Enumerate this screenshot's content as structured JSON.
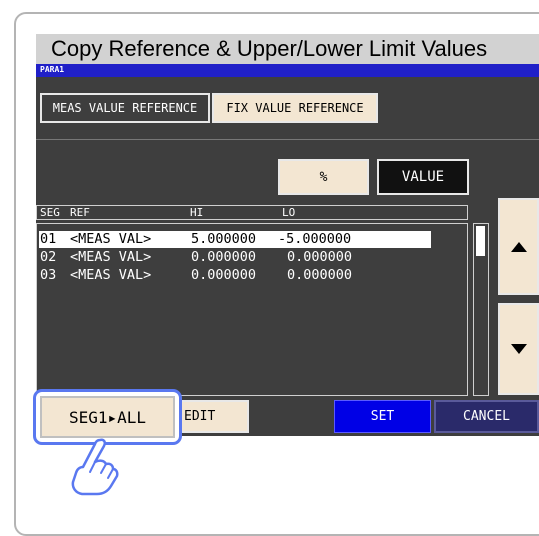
{
  "title": "Copy Reference & Upper/Lower Limit Values",
  "screen_header": "PARA1",
  "reference_tabs": [
    {
      "label": "MEAS VALUE REFERENCE",
      "selected": false
    },
    {
      "label": "FIX VALUE REFERENCE",
      "selected": true
    }
  ],
  "mode_buttons": {
    "percent": "%",
    "value": "VALUE",
    "selected": "VALUE"
  },
  "table": {
    "columns": [
      "SEG",
      "REF",
      "HI",
      "LO"
    ],
    "rows": [
      {
        "seg": "01",
        "ref": "<MEAS VAL>",
        "hi": "5.000000",
        "lo": "-5.000000",
        "selected": true
      },
      {
        "seg": "02",
        "ref": "<MEAS VAL>",
        "hi": "0.000000",
        "lo": "0.000000",
        "selected": false
      },
      {
        "seg": "03",
        "ref": "<MEAS VAL>",
        "hi": "0.000000",
        "lo": "0.000000",
        "selected": false
      }
    ]
  },
  "bottom_buttons": {
    "seg_all": "SEG1▸ALL",
    "edit": "EDIT",
    "set": "SET",
    "cancel": "CANCEL"
  },
  "icons": {
    "scroll_up": "triangle-up-icon",
    "scroll_down": "triangle-down-icon",
    "pointer": "pointing-hand-icon"
  },
  "colors": {
    "screen_bg": "#3e3e3e",
    "header_bar": "#2020c8",
    "set_button": "#0000e6",
    "cancel_button": "#2a2a6a",
    "highlight": "#5a78f0"
  }
}
